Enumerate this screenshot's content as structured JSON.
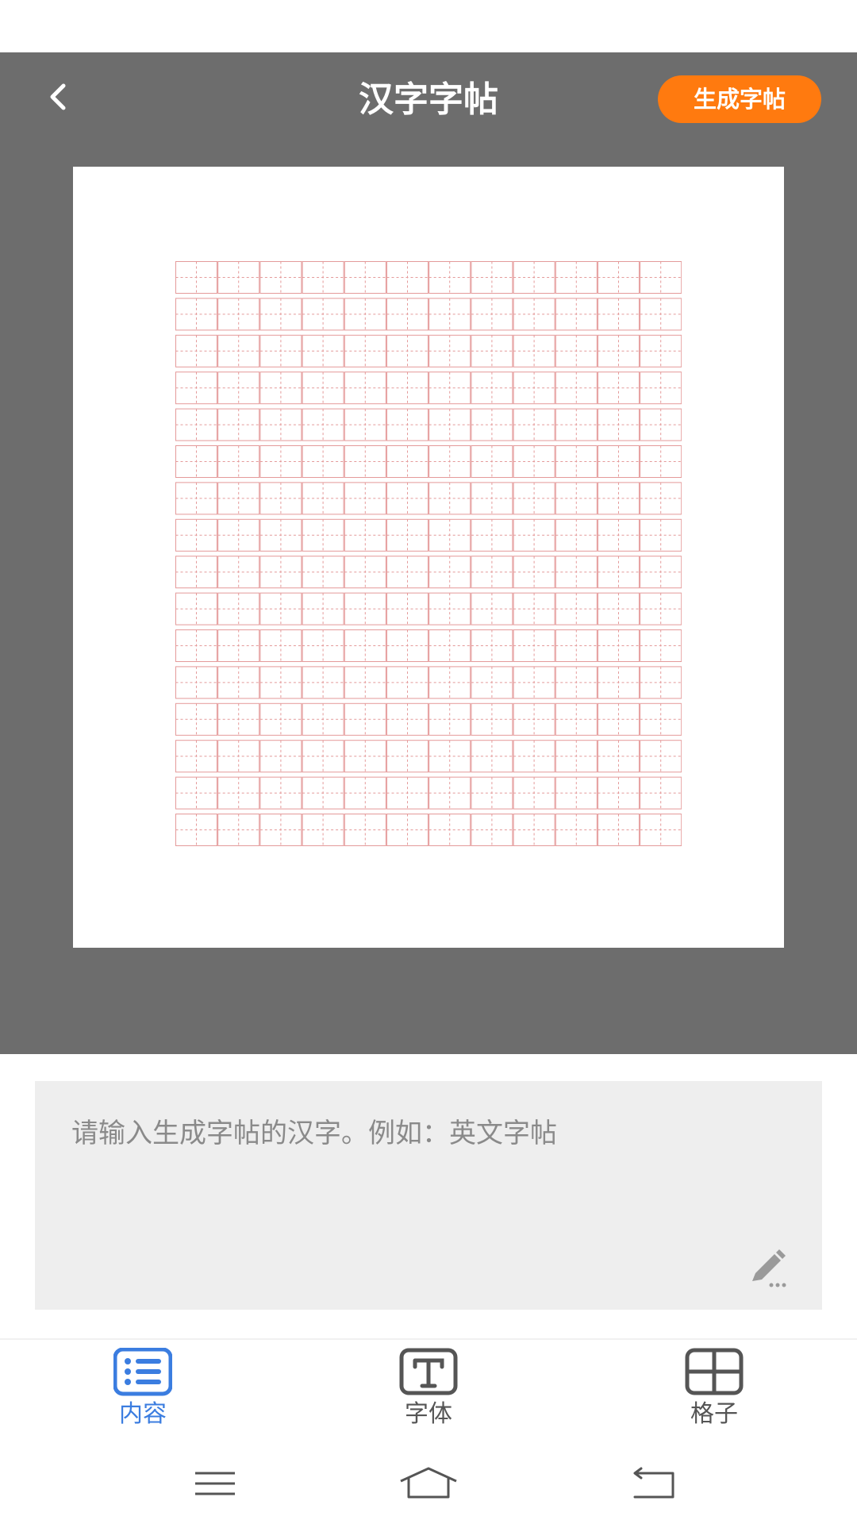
{
  "header": {
    "title": "汉字字帖",
    "generate_label": "生成字帖",
    "back_icon": "chevron-left-icon"
  },
  "preview": {
    "grid_rows": 16,
    "grid_cols": 12,
    "grid_style": "田字格",
    "grid_color": "#e49a9a",
    "background": "#6d6d6d"
  },
  "input": {
    "placeholder": "请输入生成字帖的汉字。例如：英文字帖",
    "value": "",
    "edit_icon": "pen-icon"
  },
  "tabs": [
    {
      "label": "内容",
      "icon": "list-icon",
      "active": true
    },
    {
      "label": "字体",
      "icon": "font-icon",
      "active": false
    },
    {
      "label": "格子",
      "icon": "grid-icon",
      "active": false
    }
  ],
  "system_nav": {
    "menu_icon": "menu-icon",
    "home_icon": "home-icon",
    "back_icon": "back-icon"
  },
  "colors": {
    "accent": "#ff7a0f",
    "active_tab": "#3b7de0",
    "inactive_tab": "#555555",
    "panel": "#eeeeee"
  }
}
